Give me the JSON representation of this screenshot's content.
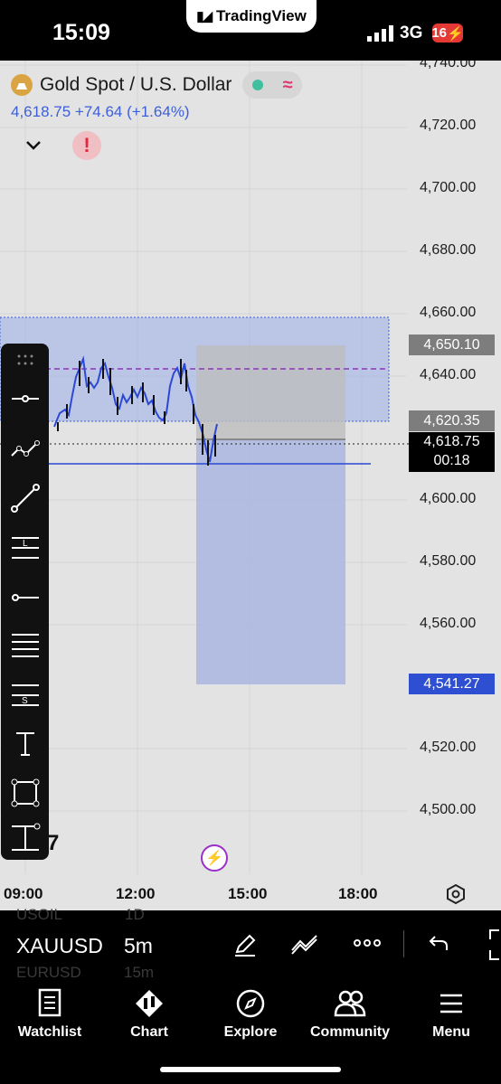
{
  "status_bar": {
    "time": "15:09",
    "app_badge": "TradingView",
    "network": "3G",
    "battery": "16"
  },
  "symbol": {
    "name": "Gold Spot / U.S. Dollar",
    "price": "4,618.75",
    "change": "+74.64",
    "change_pct": "(+1.64%)"
  },
  "price_axis": [
    "4,740.00",
    "4,720.00",
    "4,700.00",
    "4,680.00",
    "4,660.00",
    "4,640.00",
    "4,600.00",
    "4,580.00",
    "4,560.00",
    "4,520.00",
    "4,500.00"
  ],
  "price_tags": {
    "upper": "4,650.10",
    "mid": "4,620.35",
    "last_price": "4,618.75",
    "countdown": "00:18",
    "target": "4,541.27"
  },
  "time_axis": [
    "09:00",
    "12:00",
    "15:00",
    "18:00"
  ],
  "partial_glyph": "7",
  "symbol_bar": {
    "ticker": "XAUUSD",
    "interval": "5m",
    "ghost_above_ticker": "USOIL",
    "ghost_above_interval": "1D",
    "ghost_below_ticker": "EURUSD",
    "ghost_below_interval": "15m"
  },
  "nav": {
    "watchlist": "Watchlist",
    "chart": "Chart",
    "explore": "Explore",
    "community": "Community",
    "menu": "Menu"
  },
  "colors": {
    "accent_blue": "#2e4fd1",
    "tag_gray": "#7d7d7d",
    "alert_red": "#e8253b",
    "box_blue": "#a7b5e3"
  }
}
